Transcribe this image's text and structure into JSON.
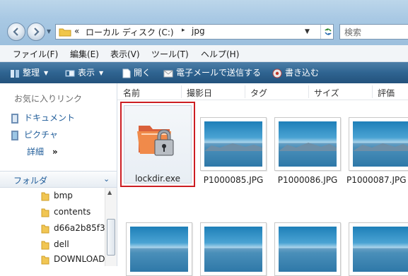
{
  "address_bar": {
    "breadcrumb_prefix": "«",
    "location": "ローカル ディスク (C:)",
    "separator": "▸",
    "current": "jpg"
  },
  "search": {
    "placeholder": "検索"
  },
  "menu": {
    "items": [
      "ファイル(F)",
      "編集(E)",
      "表示(V)",
      "ツール(T)",
      "ヘルプ(H)"
    ]
  },
  "commands": {
    "organize": "整理",
    "view": "表示",
    "open": "開く",
    "email": "電子メールで送信する",
    "burn": "書き込む"
  },
  "nav_pane": {
    "favorites_heading": "お気に入りリンク",
    "favorites": [
      "ドキュメント",
      "ピクチャ",
      "詳細"
    ],
    "more_glyph": "»",
    "folders_label": "フォルダ",
    "folders": [
      "bmp",
      "contents",
      "d66a2b85f3",
      "dell",
      "DOWNLOAD"
    ]
  },
  "columns": [
    "名前",
    "撮影日",
    "タグ",
    "サイズ",
    "評価"
  ],
  "files": [
    {
      "name": "lockdir.exe",
      "icon": "lock-folder-icon",
      "selected": true
    },
    {
      "name": "P1000085.JPG",
      "icon": "photo-thumbnail"
    },
    {
      "name": "P1000086.JPG",
      "icon": "photo-thumbnail"
    },
    {
      "name": "P1000087.JPG",
      "icon": "photo-thumbnail"
    }
  ],
  "colors": {
    "selection_outline": "#cc1e23",
    "command_bar": "#2f6491",
    "link_blue": "#1f5c99"
  }
}
